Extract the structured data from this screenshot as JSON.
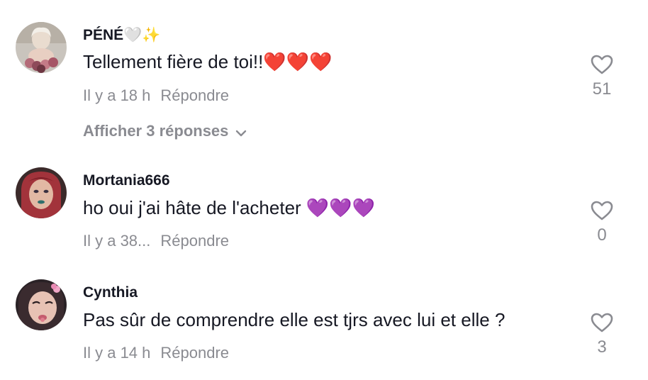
{
  "comments": [
    {
      "username": "PÉNÉ🤍✨",
      "text": "Tellement fière de toi!!❤️❤️❤️",
      "time": "Il y a 18 h",
      "reply_label": "Répondre",
      "likes": "51",
      "view_replies": "Afficher 3 réponses"
    },
    {
      "username": "Mortania666",
      "text": "ho oui j'ai hâte de l'acheter 💜💜💜",
      "time": "Il y a 38...",
      "reply_label": "Répondre",
      "likes": "0"
    },
    {
      "username": "Cynthia",
      "text": "Pas sûr de comprendre elle est tjrs avec lui et elle ?",
      "time": "Il y a 14 h",
      "reply_label": "Répondre",
      "likes": "3"
    }
  ],
  "icons": {
    "like": "heart-outline-icon",
    "expand": "chevron-down-icon"
  },
  "colors": {
    "text_primary": "#161823",
    "text_secondary": "#8a8b91",
    "heart_red": "#e8242f",
    "heart_purple": "#9b5de5"
  }
}
